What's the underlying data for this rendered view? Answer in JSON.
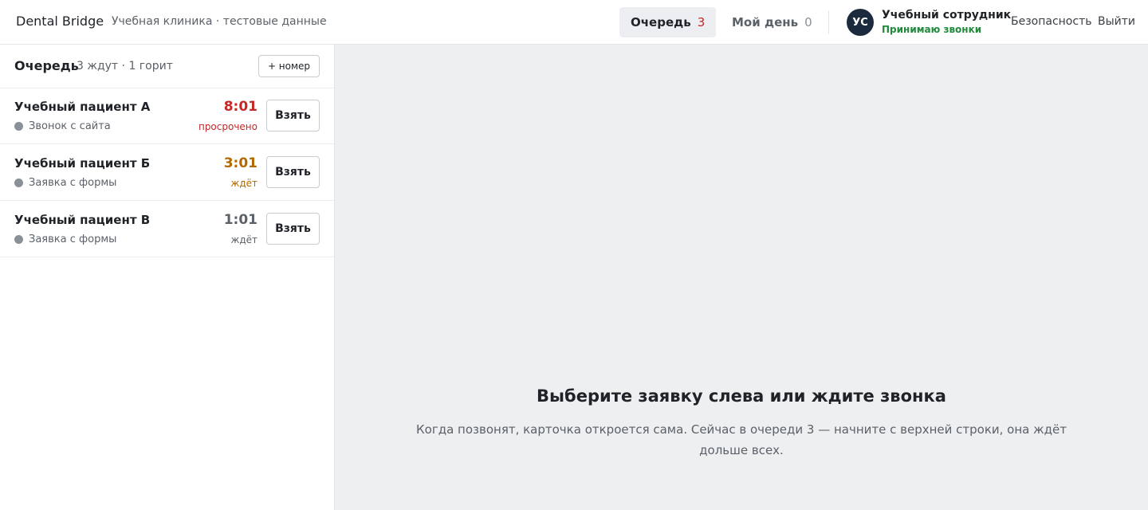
{
  "header": {
    "brand": "Dental Bridge",
    "clinic": "Учебная клиника · тестовые данные",
    "tabs": [
      {
        "label": "Очередь",
        "count": "3"
      },
      {
        "label": "Мой день",
        "count": "0"
      }
    ],
    "user": {
      "initials": "УС",
      "name": "Учебный сотрудник",
      "status": "Принимаю звонки"
    },
    "links": {
      "security": "Безопасность",
      "logout": "Выйти"
    }
  },
  "queue": {
    "title": "Очередь",
    "summary": "3 ждут · 1 горит",
    "add_label": "+ номер",
    "take_label": "Взять",
    "items": [
      {
        "name": "Учебный пациент А",
        "source": "Звонок с сайта",
        "time": "8:01",
        "state": "просрочено"
      },
      {
        "name": "Учебный пациент Б",
        "source": "Заявка с формы",
        "time": "3:01",
        "state": "ждёт"
      },
      {
        "name": "Учебный пациент В",
        "source": "Заявка с формы",
        "time": "1:01",
        "state": "ждёт"
      }
    ]
  },
  "main": {
    "empty_title": "Выберите заявку слева или ждите звонка",
    "empty_text": "Когда позвонят, карточка откроется сама. Сейчас в очереди 3 — начните с верхней строки, она ждёт дольше всех."
  },
  "colors": {
    "overdue": "#c62828",
    "waiting_warn": "#b26a00",
    "waiting": "#5b6168",
    "online": "#1f8a3b",
    "avatar_bg": "#1b2a3d"
  }
}
